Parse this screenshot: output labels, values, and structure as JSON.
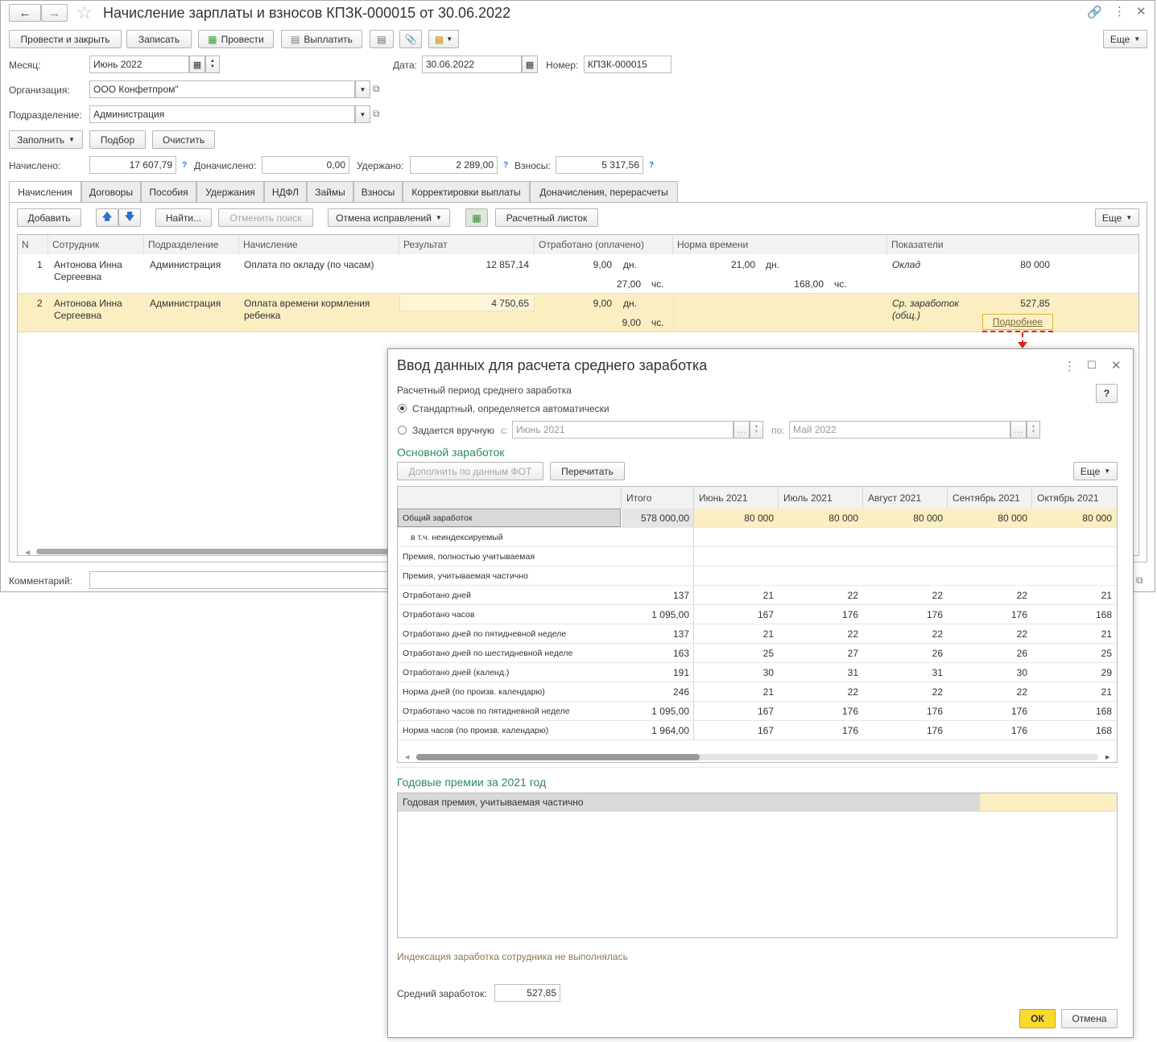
{
  "window": {
    "title": "Начисление зарплаты и взносов КПЗК-000015 от 30.06.2022",
    "toolbar": {
      "post_close": "Провести и закрыть",
      "save": "Записать",
      "post": "Провести",
      "pay": "Выплатить",
      "more": "Еще"
    }
  },
  "form": {
    "month_label": "Месяц:",
    "month_value": "Июнь 2022",
    "date_label": "Дата:",
    "date_value": "30.06.2022",
    "number_label": "Номер:",
    "number_value": "КПЗК-000015",
    "org_label": "Организация:",
    "org_value": "ООО Конфетпром\"",
    "dept_label": "Подразделение:",
    "dept_value": "Администрация",
    "fill": "Заполнить",
    "select": "Подбор",
    "clear": "Очистить",
    "accrued_label": "Начислено:",
    "accrued_value": "17 607,79",
    "extra_label": "Доначислено:",
    "extra_value": "0,00",
    "withheld_label": "Удержано:",
    "withheld_value": "2 289,00",
    "contrib_label": "Взносы:",
    "contrib_value": "5 317,56",
    "help": "?",
    "comment_label": "Комментарий:"
  },
  "tabs": [
    "Начисления",
    "Договоры",
    "Пособия",
    "Удержания",
    "НДФЛ",
    "Займы",
    "Взносы",
    "Корректировки выплаты",
    "Доначисления, перерасчеты"
  ],
  "accruals_toolbar": {
    "add": "Добавить",
    "find": "Найти...",
    "cancel_search": "Отменить поиск",
    "cancel_fixes": "Отмена исправлений",
    "payslip": "Расчетный листок",
    "more": "Еще"
  },
  "table": {
    "headers": [
      "N",
      "Сотрудник",
      "Подразделение",
      "Начисление",
      "Результат",
      "Отработано (оплачено)",
      "Норма времени",
      "Показатели"
    ],
    "rows": [
      {
        "n": "1",
        "employee_1": "Антонова Инна",
        "employee_2": "Сергеевна",
        "dept": "Администрация",
        "accrual": "Оплата по окладу (по часам)",
        "result": "12 857,14",
        "worked_days": "9,00",
        "days_unit": "дн.",
        "worked_hours": "27,00",
        "hours_unit": "чс.",
        "norm_days": "21,00",
        "norm_days_unit": "дн.",
        "norm_hours": "168,00",
        "norm_hours_unit": "чс.",
        "indicator": "Оклад",
        "indicator_value": "80 000"
      },
      {
        "n": "2",
        "employee_1": "Антонова Инна",
        "employee_2": "Сергеевна",
        "dept": "Администрация",
        "accrual_1": "Оплата времени кормления",
        "accrual_2": "ребенка",
        "result": "4 750,65",
        "worked_days": "9,00",
        "days_unit": "дн.",
        "worked_hours": "9,00",
        "hours_unit": "чс.",
        "indicator_1": "Ср. заработок",
        "indicator_2": "(общ.)",
        "indicator_value": "527,85",
        "details_link": "Подробнее"
      }
    ]
  },
  "dialog": {
    "title": "Ввод данных для расчета среднего заработка",
    "period_label": "Расчетный период среднего заработка",
    "help": "?",
    "radio_standard": "Стандартный, определяется автоматически",
    "radio_manual": "Задается вручную",
    "from_label": "с:",
    "from_value": "Июнь 2021",
    "to_label": "по:",
    "to_value": "Май 2022",
    "main_section": "Основной заработок",
    "fill_fot": "Дополнить по данным ФОТ",
    "recalc": "Перечитать",
    "more": "Еще",
    "grid_headers": [
      "",
      "Итого",
      "Июнь 2021",
      "Июль 2021",
      "Август 2021",
      "Сентябрь 2021",
      "Октябрь 2021"
    ],
    "grid_rows": [
      {
        "label": "Общий заработок",
        "values": [
          "578 000,00",
          "80 000",
          "80 000",
          "80 000",
          "80 000",
          "80 000"
        ]
      },
      {
        "label": "в т.ч. неиндексируемый",
        "values": [
          "",
          "",
          "",
          "",
          "",
          ""
        ]
      },
      {
        "label": "Премия, полностью учитываемая",
        "values": [
          "",
          "",
          "",
          "",
          "",
          ""
        ]
      },
      {
        "label": "Премия, учитываемая частично",
        "values": [
          "",
          "",
          "",
          "",
          "",
          ""
        ]
      },
      {
        "label": "Отработано дней",
        "values": [
          "137",
          "21",
          "22",
          "22",
          "22",
          "21"
        ]
      },
      {
        "label": "Отработано часов",
        "values": [
          "1 095,00",
          "167",
          "176",
          "176",
          "176",
          "168"
        ]
      },
      {
        "label": "Отработано дней по пятидневной неделе",
        "values": [
          "137",
          "21",
          "22",
          "22",
          "22",
          "21"
        ]
      },
      {
        "label": "Отработано дней по шестидневной неделе",
        "values": [
          "163",
          "25",
          "27",
          "26",
          "26",
          "25"
        ]
      },
      {
        "label": "Отработано дней (календ.)",
        "values": [
          "191",
          "30",
          "31",
          "31",
          "30",
          "29"
        ]
      },
      {
        "label": "Норма дней (по произв. календарю)",
        "values": [
          "246",
          "21",
          "22",
          "22",
          "22",
          "21"
        ]
      },
      {
        "label": "Отработано часов по пятидневной неделе",
        "values": [
          "1 095,00",
          "167",
          "176",
          "176",
          "176",
          "168"
        ]
      },
      {
        "label": "Норма часов (по произв. календарю)",
        "values": [
          "1 964,00",
          "167",
          "176",
          "176",
          "176",
          "168"
        ]
      }
    ],
    "bonus_section": "Годовые премии за 2021 год",
    "bonus_row": "Годовая премия, учитываемая частично",
    "indexation_note": "Индексация заработка сотрудника не выполнялась",
    "avg_label": "Средний заработок:",
    "avg_value": "527,85",
    "ok": "ОК",
    "cancel": "Отмена"
  }
}
